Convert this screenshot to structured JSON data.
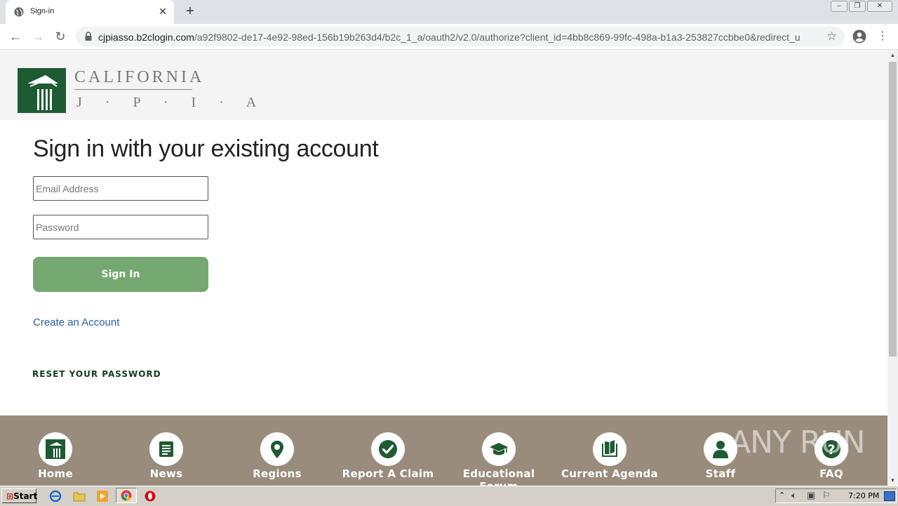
{
  "browser": {
    "tab_title": "Sign-in",
    "url_host": "cjpiasso.b2clogin.com",
    "url_path": "/a92f9802-de17-4e92-98ed-156b19b263d4/b2c_1_a/oauth2/v2.0/authorize?client_id=4bb8c869-99fc-498a-b1a3-253827ccbbe0&redirect_u..."
  },
  "logo": {
    "line1": "CALIFORNIA",
    "line2": "J · P · I · A"
  },
  "signin": {
    "title": "Sign in with your existing account",
    "email_placeholder": "Email Address",
    "password_placeholder": "Password",
    "signin_label": "Sign In",
    "create_account": "Create an Account",
    "reset_password": "RESET YOUR PASSWORD"
  },
  "footer_nav": [
    {
      "label": "Home",
      "icon": "building-icon"
    },
    {
      "label": "News",
      "icon": "newspaper-icon"
    },
    {
      "label": "Regions",
      "icon": "map-pin-icon"
    },
    {
      "label": "Report A Claim",
      "icon": "check-circle-icon"
    },
    {
      "label": "Educational Forum",
      "icon": "graduation-cap-icon"
    },
    {
      "label": "Current Agenda",
      "icon": "book-icon"
    },
    {
      "label": "Staff",
      "icon": "person-icon"
    },
    {
      "label": "FAQ",
      "icon": "question-icon"
    }
  ],
  "watermark": "ANY RUN",
  "taskbar": {
    "start_label": "Start",
    "clock": "7:20 PM"
  },
  "colors": {
    "brand_green": "#1e5a32",
    "button_green": "#74a870",
    "footer_bg": "#9a8c7c",
    "link_blue": "#2a5da8"
  }
}
